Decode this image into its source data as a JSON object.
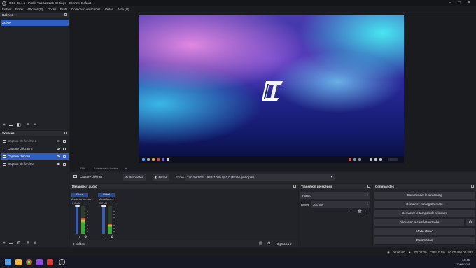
{
  "window": {
    "title": "OBS 32.1.1 - Profil: Tweaks Lab Settings - Scènes: Default"
  },
  "menu": [
    "Fichier",
    "Editer",
    "Afficher (V)",
    "Docks",
    "Profil",
    "Collection de scènes",
    "Outils",
    "Aide (H)"
  ],
  "scenes": {
    "title": "Scènes",
    "items": [
      "Scène"
    ]
  },
  "sources": {
    "title": "Sources",
    "items": [
      {
        "label": "Capture de fenêtre 2",
        "state": "hidden"
      },
      {
        "label": "Capture d'écran 2",
        "state": "normal"
      },
      {
        "label": "Capture d'écran",
        "state": "selected"
      },
      {
        "label": "Capture de fenêtre",
        "state": "normal"
      }
    ]
  },
  "preview": {
    "zoom": "55%",
    "mode": "Adapter à la fenêtre",
    "logo_text": "LT"
  },
  "context": {
    "source_label": "Capture d'écran",
    "properties_label": "Propriétés",
    "filters_label": "Filtres",
    "screen_label": "Écran",
    "screen_value": "24G2W1G4: 1920x1080 @ 0,0 (Écran principal)"
  },
  "mixer": {
    "title": "Mélangeur audio",
    "channels": [
      {
        "group": "Global",
        "name": "Audio du bureau",
        "db": "0.0 dB",
        "level": 0.55
      },
      {
        "group": "Global",
        "name": "Micro/Aux",
        "db": "0.0 dB",
        "level": 0.35
      }
    ],
    "hidden_count": "0 hidden",
    "options_label": "Options"
  },
  "transitions": {
    "title": "Transition de scènes",
    "type": "Fondu",
    "duration_label": "Durée",
    "duration_value": "300 ms"
  },
  "controls": {
    "title": "Commandes",
    "buttons": [
      "Commencer le streaming",
      "Démarrer l'enregistrement",
      "Démarrer le tampon de relecture",
      "Démarrer la caméra virtuelle",
      "Mode studio",
      "Paramètres"
    ]
  },
  "status": {
    "stream_time": "00:00:00",
    "rec_time": "00:00:00",
    "cpu": "CPU: 0.5%",
    "fps": "60.00 / 60.00 FPS"
  },
  "taskbar": {
    "time": "16:45",
    "date": "10/06/2026"
  }
}
